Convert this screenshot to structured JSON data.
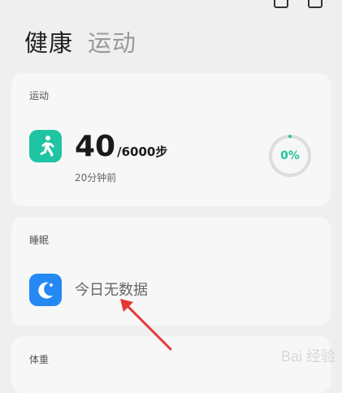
{
  "header": {
    "active_tab": "健康",
    "inactive_tab": "运动"
  },
  "exercise_card": {
    "title": "运动",
    "icon": "running-person-icon",
    "icon_color": "#1fc4a2",
    "steps": "40",
    "goal": "/6000步",
    "updated": "20分钟前",
    "progress_text": "0%",
    "progress_fraction": 0
  },
  "sleep_card": {
    "title": "睡眠",
    "icon": "moon-icon",
    "icon_color": "#2489f2",
    "status": "今日无数据"
  },
  "weight_card": {
    "title": "体重"
  },
  "annotation": {
    "arrow_color": "#e53935"
  },
  "watermark": {
    "text": "Bai 经验"
  }
}
